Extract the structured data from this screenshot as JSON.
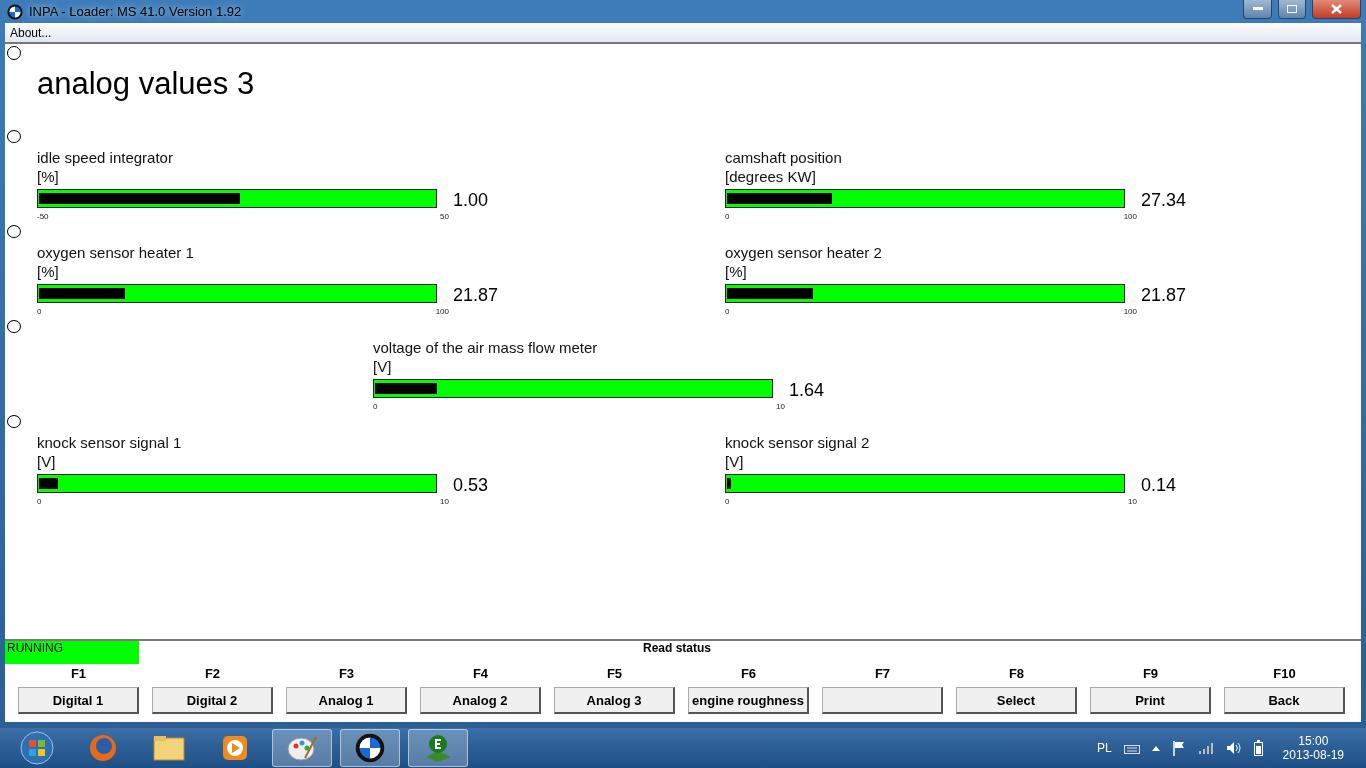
{
  "window": {
    "title": "INPA - Loader:  MS 41.0 Version 1.92"
  },
  "menu": [
    "About..."
  ],
  "heading": "analog values 3",
  "rows": [
    {
      "kind": "pair",
      "gauges": [
        {
          "name": "idle speed integrator",
          "unit": "[%]",
          "min": "-50",
          "max": "50",
          "value": "1.00",
          "level": 0.51
        },
        {
          "name": "camshaft position",
          "unit": "[degrees KW]",
          "min": "0",
          "max": "100",
          "value": "27.34",
          "level": 0.27
        }
      ]
    },
    {
      "kind": "pair",
      "gauges": [
        {
          "name": "oxygen sensor heater 1",
          "unit": "[%]",
          "min": "0",
          "max": "100",
          "value": "21.87",
          "level": 0.22
        },
        {
          "name": "oxygen sensor heater 2",
          "unit": "[%]",
          "min": "0",
          "max": "100",
          "value": "21.87",
          "level": 0.22
        }
      ]
    },
    {
      "kind": "single",
      "gauges": [
        {
          "name": "voltage of the air mass flow meter",
          "unit": "[V]",
          "min": "0",
          "max": "10",
          "value": "1.64",
          "level": 0.16
        }
      ]
    },
    {
      "kind": "pair",
      "gauges": [
        {
          "name": "knock sensor signal 1",
          "unit": "[V]",
          "min": "0",
          "max": "10",
          "value": "0.53",
          "level": 0.053
        },
        {
          "name": "knock sensor signal 2",
          "unit": "[V]",
          "min": "0",
          "max": "10",
          "value": "0.14",
          "level": 0.014
        }
      ]
    }
  ],
  "status": {
    "state": "RUNNING",
    "message": "Read status"
  },
  "function_keys": [
    {
      "key": "F1",
      "label": "Digital 1"
    },
    {
      "key": "F2",
      "label": "Digital 2"
    },
    {
      "key": "F3",
      "label": "Analog 1"
    },
    {
      "key": "F4",
      "label": "Analog 2"
    },
    {
      "key": "F5",
      "label": "Analog 3"
    },
    {
      "key": "F6",
      "label": "engine roughness"
    },
    {
      "key": "F7"
    },
    {
      "key": "F8",
      "label": "Select"
    },
    {
      "key": "F9",
      "label": "Print"
    },
    {
      "key": "F10",
      "label": "Back"
    }
  ],
  "taskbar": {
    "language": "PL",
    "time": "15:00",
    "date": "2013-08-19"
  }
}
